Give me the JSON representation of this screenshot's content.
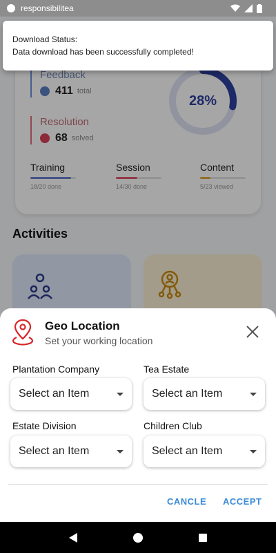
{
  "status_bar": {
    "app_name": "responsibilitea",
    "time": ""
  },
  "notification": {
    "title": "Download Status:",
    "message": "Data download has been successfully completed!"
  },
  "dashboard": {
    "feedback": {
      "label": "Feedback",
      "value": "411",
      "unit": "total"
    },
    "resolution": {
      "label": "Resolution",
      "value": "68",
      "unit": "solved"
    },
    "donut_percent": "28%",
    "donut_fraction": 0.28,
    "progress": [
      {
        "label": "Training",
        "detail": "18/20  done",
        "fraction": 0.9,
        "color": "#6a7fd6"
      },
      {
        "label": "Session",
        "detail": "14/30  done",
        "fraction": 0.47,
        "color": "#e05b72"
      },
      {
        "label": "Content",
        "detail": "5/23  viewed",
        "fraction": 0.22,
        "color": "#e3a93b"
      }
    ],
    "activities_title": "Activities"
  },
  "geo_sheet": {
    "title": "Geo Location",
    "subtitle": "Set your working location",
    "fields": [
      {
        "label": "Plantation Company",
        "value": "Select an Item"
      },
      {
        "label": "Tea Estate",
        "value": "Select an Item"
      },
      {
        "label": "Estate Division",
        "value": "Select an Item"
      },
      {
        "label": "Children Club",
        "value": "Select an Item"
      }
    ],
    "cancel_label": "CANCLE",
    "accept_label": "ACCEPT"
  },
  "colors": {
    "accent": "#3b8ad6",
    "pin_red": "#d9262a",
    "donut": "#2f3fa0"
  }
}
